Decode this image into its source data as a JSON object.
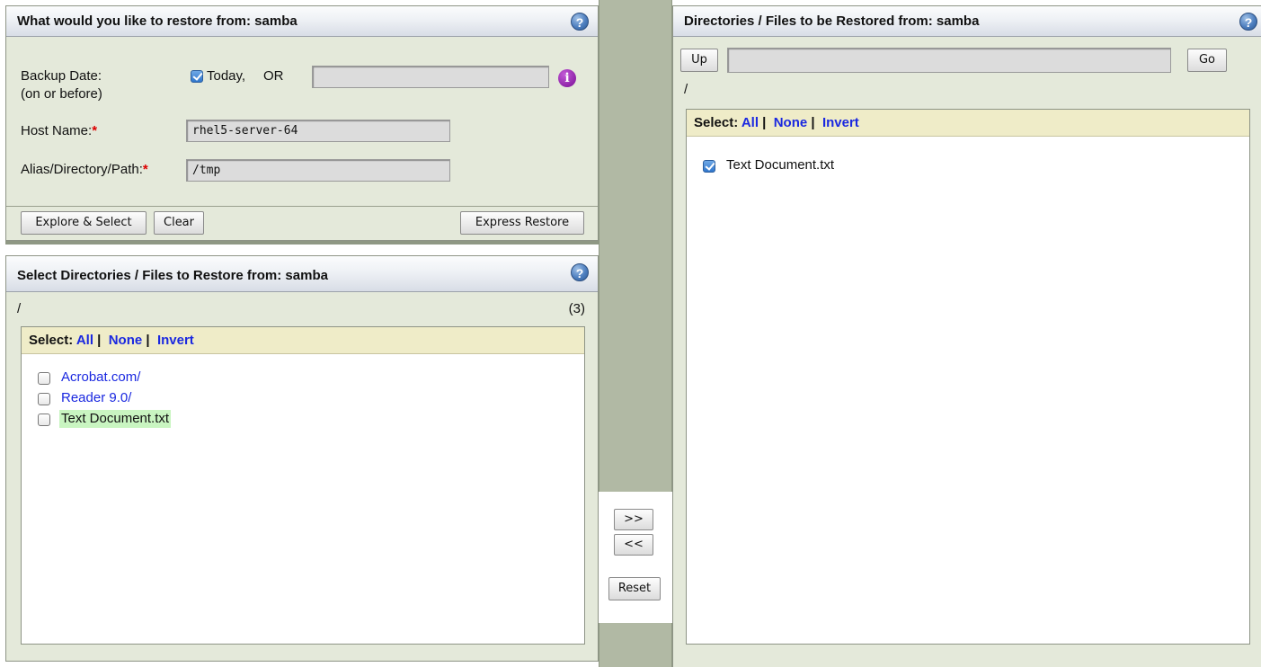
{
  "restore_panel": {
    "title": "What would you like to restore from: samba",
    "help_icon": "question-mark-icon",
    "backup_date_label": "Backup Date:",
    "backup_date_sub": "(on or before)",
    "today_label": "Today,",
    "or_label": "OR",
    "date_value": "",
    "info_icon": "info-icon",
    "host_label": "Host Name:",
    "host_value": "rhel5-server-64",
    "path_label": "Alias/Directory/Path:",
    "path_value": "/tmp",
    "required_mark": "*",
    "explore_button": "Explore & Select",
    "clear_button": "Clear",
    "express_button": "Express Restore"
  },
  "select_panel": {
    "title": "Select Directories / Files to Restore from: samba",
    "path": "/",
    "count": "(3)",
    "select_label": "Select:",
    "all": "All",
    "none": "None",
    "invert": "Invert",
    "separator": "|",
    "items": [
      {
        "label": "Acrobat.com/",
        "checked": false
      },
      {
        "label": "Reader 9.0/",
        "checked": false
      },
      {
        "label": "Text Document.txt",
        "checked": false
      }
    ]
  },
  "transfer": {
    "add": ">>",
    "remove": "<<",
    "reset": "Reset"
  },
  "restore_list_panel": {
    "title": "Directories / Files to be Restored from: samba",
    "up_button": "Up",
    "go_button": "Go",
    "path_input": "",
    "path": "/",
    "select_label": "Select:",
    "all": "All",
    "none": "None",
    "invert": "Invert",
    "separator": "|",
    "items": [
      {
        "label": "Text Document.txt",
        "checked": true
      }
    ]
  },
  "colors": {
    "panel_bg": "#e4e9da",
    "select_bar_bg": "#efecc8",
    "link": "#1a28e0",
    "highlight": "#c9f5c1",
    "required": "#dd0000"
  }
}
